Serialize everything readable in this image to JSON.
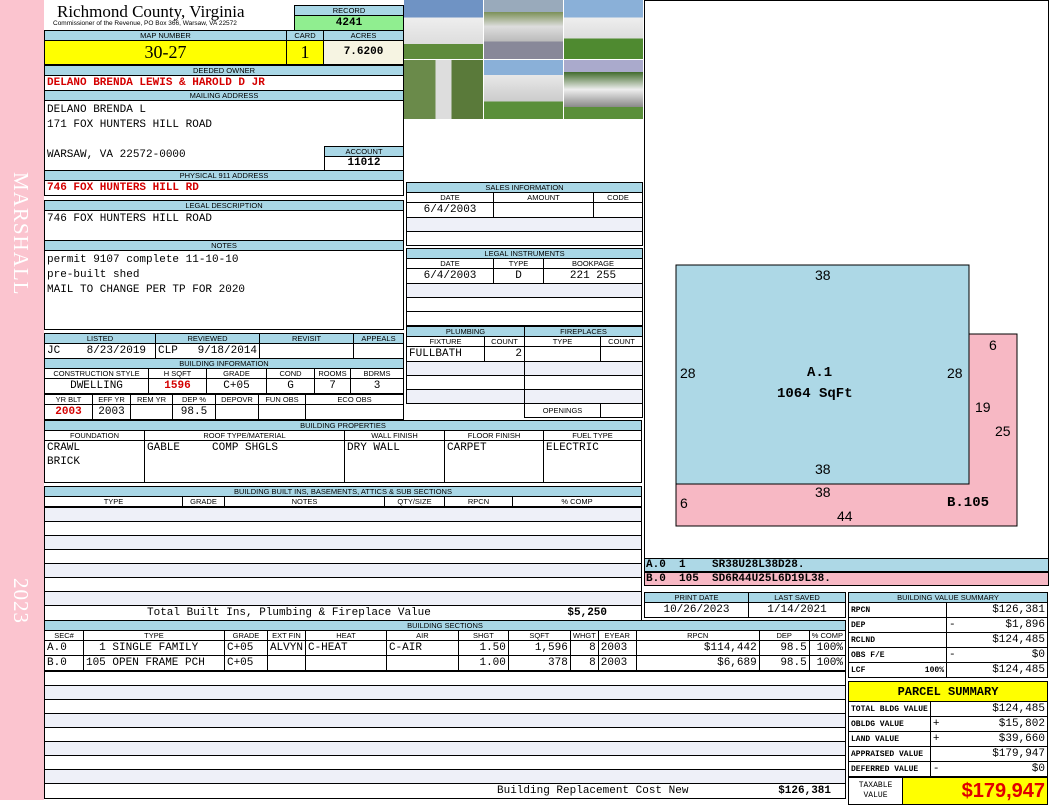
{
  "side": {
    "district": "MARSHALL",
    "year": "2023"
  },
  "header": {
    "county": "Richmond County, Virginia",
    "office": "Commissioner of the Revenue, PO Box 366, Warsaw, VA 22572",
    "record_label": "RECORD",
    "record": "4241"
  },
  "parcel": {
    "map_label": "MAP NUMBER",
    "map": "30-27",
    "card_label": "CARD",
    "card": "1",
    "acres_label": "ACRES",
    "acres": "7.6200"
  },
  "owner": {
    "label": "DEEDED OWNER",
    "name": "DELANO BRENDA LEWIS & HAROLD D JR",
    "mail_label": "MAILING ADDRESS",
    "mail": [
      "DELANO BRENDA L",
      "171 FOX HUNTERS HILL ROAD",
      "",
      "WARSAW, VA 22572-0000"
    ],
    "account_label": "ACCOUNT",
    "account": "11012"
  },
  "physical": {
    "label": "PHYSICAL 911 ADDRESS",
    "value": "746 FOX HUNTERS HILL RD"
  },
  "legal": {
    "label": "LEGAL DESCRIPTION",
    "value": "746 FOX HUNTERS HILL ROAD"
  },
  "notes": {
    "label": "NOTES",
    "lines": [
      "permit 9107 complete 11-10-10",
      "pre-built shed",
      "MAIL TO CHANGE PER TP FOR 2020"
    ]
  },
  "listing": {
    "headers": [
      "LISTED",
      "REVIEWED",
      "REVISIT",
      "APPEALS"
    ],
    "values": [
      "JC    8/23/2019",
      "CLP   9/18/2014",
      "",
      ""
    ]
  },
  "building_info": {
    "title": "BUILDING INFORMATION",
    "h1": [
      "CONSTRUCTION STYLE",
      "H SQFT",
      "GRADE",
      "COND",
      "ROOMS",
      "BDRMS"
    ],
    "v1": [
      "DWELLING",
      "1596",
      "C+05",
      "G",
      "7",
      "3"
    ],
    "h2": [
      "YR BLT",
      "EFF YR",
      "REM YR",
      "DEP %",
      "DEPOVR",
      "FUN OBS",
      "ECO OBS"
    ],
    "v2": [
      "2003",
      "2003",
      "",
      "98.5",
      "",
      "",
      ""
    ]
  },
  "properties": {
    "title": "BUILDING PROPERTIES",
    "headers": [
      "FOUNDATION",
      "ROOF TYPE/MATERIAL",
      "WALL FINISH",
      "FLOOR FINISH",
      "FUEL TYPE"
    ],
    "foundation": [
      "CRAWL",
      "BRICK"
    ],
    "roof_type": "GABLE",
    "roof_material": "COMP SHGLS",
    "wall": "DRY WALL",
    "floor": "CARPET",
    "fuel": "ELECTRIC"
  },
  "builtins": {
    "title": "BUILDING BUILT INS, BASEMENTS, ATTICS & SUB SECTIONS",
    "headers": [
      "TYPE",
      "GRADE",
      "NOTES",
      "QTY/SIZE",
      "RPCN",
      "% COMP"
    ],
    "total_label": "Total Built Ins, Plumbing & Fireplace Value",
    "total": "$5,250"
  },
  "sales": {
    "title": "SALES INFORMATION",
    "headers": [
      "DATE",
      "AMOUNT",
      "CODE"
    ],
    "rows": [
      [
        "6/4/2003",
        "",
        ""
      ]
    ]
  },
  "instruments": {
    "title": "LEGAL INSTRUMENTS",
    "headers": [
      "DATE",
      "TYPE",
      "BOOKPAGE"
    ],
    "rows": [
      [
        "6/4/2003",
        "D",
        "221 255"
      ]
    ]
  },
  "plumbing": {
    "title": "PLUMBING",
    "headers": [
      "FIXTURE",
      "COUNT"
    ],
    "rows": [
      [
        "FULLBATH",
        "2"
      ]
    ]
  },
  "fireplaces": {
    "title": "FIREPLACES",
    "headers": [
      "TYPE",
      "COUNT"
    ],
    "openings_label": "OPENINGS"
  },
  "sketch": {
    "a_top": "38",
    "a_left": "28",
    "a_right": "28",
    "a_bottom": "38",
    "a_label": "A.1",
    "a_area": "1064 SqFt",
    "b_top": "6",
    "b_right1": "19",
    "b_right2": "25",
    "b_top2": "38",
    "b_bottom": "44",
    "b_left": "6",
    "b_label": "B.105",
    "codes": [
      [
        "A.0",
        "1",
        "SR38U28L38D28."
      ],
      [
        "B.0",
        "105",
        "SD6R44U25L6D19L38."
      ]
    ],
    "colors": {
      "a": "#add8e6",
      "b": "#f7b8c4"
    }
  },
  "dates": {
    "print_label": "PRINT DATE",
    "print": "10/26/2023",
    "saved_label": "LAST SAVED",
    "saved": "1/14/2021"
  },
  "sections": {
    "title": "BUILDING SECTIONS",
    "headers": [
      "SEC#",
      "TYPE",
      "GRADE",
      "EXT FIN",
      "HEAT",
      "AIR",
      "SHGT",
      "SQFT",
      "WHGT",
      "EYEAR",
      "RPCN",
      "DEP",
      "% COMP"
    ],
    "rows": [
      [
        "A.0",
        "  1 SINGLE FAMILY",
        "C+05",
        "ALVYN",
        "C-HEAT",
        "C-AIR",
        "1.50",
        "1,596",
        "8",
        "2003",
        "$114,442",
        "98.5",
        "100%"
      ],
      [
        "B.0",
        "105 OPEN FRAME PCH",
        "C+05",
        "",
        "",
        "",
        "1.00",
        "378",
        "8",
        "2003",
        "$6,689",
        "98.5",
        "100%"
      ]
    ],
    "replacement_label": "Building Replacement Cost New",
    "replacement": "$126,381"
  },
  "value_summary": {
    "title": "BUILDING VALUE SUMMARY",
    "rows": [
      [
        "RPCN",
        "",
        "",
        "$126,381"
      ],
      [
        "DEP",
        "",
        "-",
        "$1,896"
      ],
      [
        "RCLND",
        "",
        "",
        "$124,485"
      ],
      [
        "OBS F/E",
        "",
        "-",
        "$0"
      ],
      [
        "LCF",
        "100%",
        "",
        "$124,485"
      ]
    ]
  },
  "parcel_summary": {
    "title": "PARCEL SUMMARY",
    "rows": [
      [
        "TOTAL BLDG VALUE",
        "",
        "$124,485"
      ],
      [
        "OBLDG VALUE",
        "+",
        "$15,802"
      ],
      [
        "LAND VALUE",
        "+",
        "$39,660"
      ],
      [
        "APPRAISED VALUE",
        "",
        "$179,947"
      ],
      [
        "DEFERRED VALUE",
        "-",
        "$0"
      ]
    ],
    "taxable_label": "TAXABLE VALUE",
    "taxable": "$179,947"
  }
}
